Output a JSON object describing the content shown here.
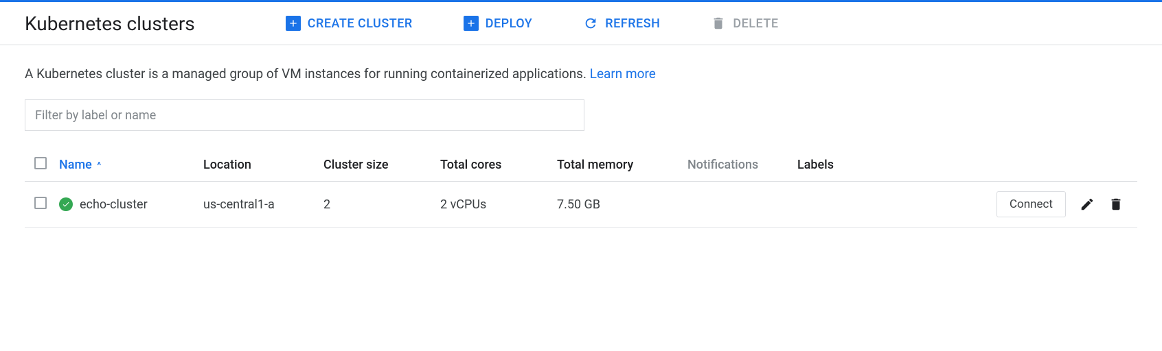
{
  "header": {
    "title": "Kubernetes clusters",
    "actions": {
      "create": "CREATE CLUSTER",
      "deploy": "DEPLOY",
      "refresh": "REFRESH",
      "delete": "DELETE"
    }
  },
  "description": {
    "text": "A Kubernetes cluster is a managed group of VM instances for running containerized applications. ",
    "link": "Learn more"
  },
  "filter": {
    "placeholder": "Filter by label or name"
  },
  "table": {
    "columns": {
      "name": "Name",
      "location": "Location",
      "cluster_size": "Cluster size",
      "total_cores": "Total cores",
      "total_memory": "Total memory",
      "notifications": "Notifications",
      "labels": "Labels"
    },
    "rows": [
      {
        "name": "echo-cluster",
        "location": "us-central1-a",
        "cluster_size": "2",
        "total_cores": "2 vCPUs",
        "total_memory": "7.50 GB",
        "notifications": "",
        "labels": "",
        "connect": "Connect"
      }
    ]
  }
}
